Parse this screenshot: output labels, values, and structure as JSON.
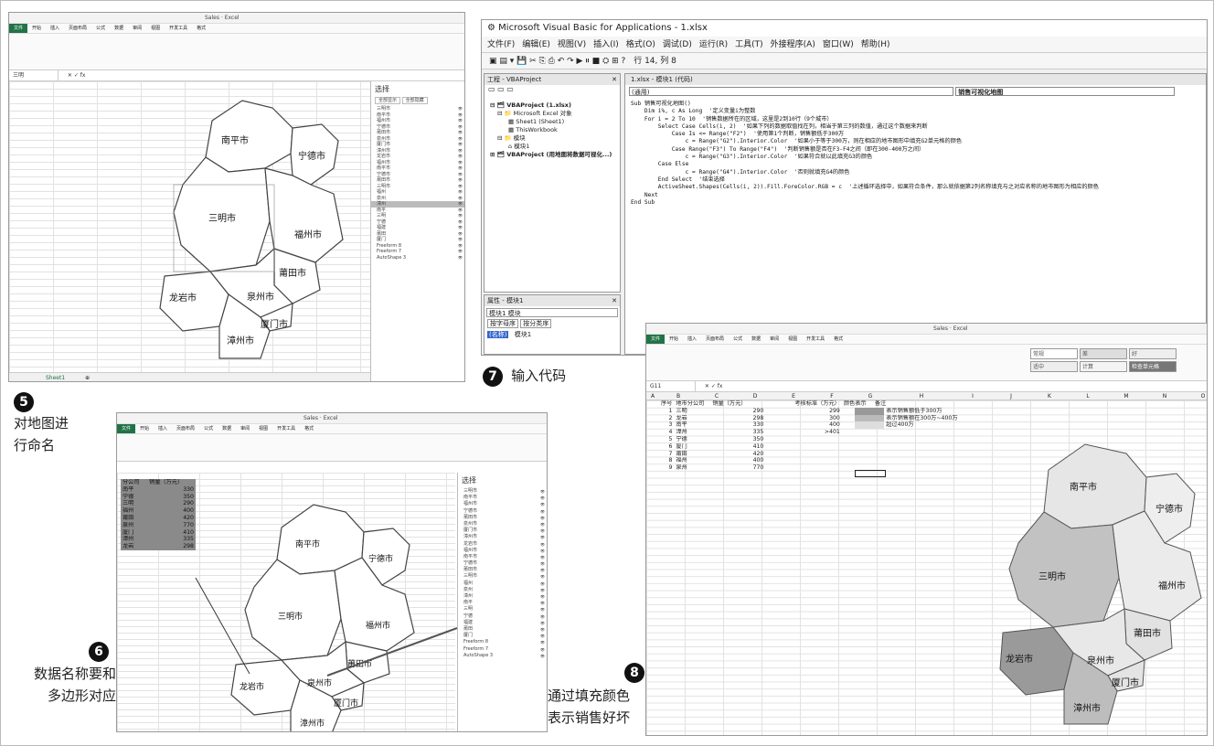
{
  "shot5": {
    "window_title": "Sales · Excel",
    "tabs": [
      "文件",
      "开始",
      "插入",
      "页面布局",
      "公式",
      "数据",
      "审阅",
      "视图",
      "开发工具",
      "格式"
    ],
    "name_box": "三明",
    "sheet_tab": "Sheet1",
    "selection_pane": {
      "title": "选择",
      "show_all": "全部显示",
      "hide_all": "全部隐藏",
      "items": [
        "三明市",
        "南平市",
        "福州市",
        "宁德市",
        "莆田市",
        "泉州市",
        "厦门市",
        "漳州市",
        "龙岩市",
        "福州市",
        "南平市",
        "宁德市",
        "莆田市",
        "三明市",
        "福州",
        "泉州",
        "漳州",
        "南平",
        "三明",
        "宁德",
        "福建",
        "莆田",
        "厦门",
        "Freeform 8",
        "Freeform 7",
        "AutoShape 3"
      ]
    },
    "map_labels": [
      "南平市",
      "宁德市",
      "三明市",
      "福州市",
      "莆田市",
      "龙岩市",
      "泉州市",
      "厦门市",
      "漳州市"
    ]
  },
  "step5": {
    "number": "5",
    "caption_line1": "对地图进",
    "caption_line2": "行命名"
  },
  "step6": {
    "number": "6",
    "caption_line1": "数据名称要和",
    "caption_line2": "多边形对应"
  },
  "step7": {
    "number": "7",
    "caption": "输入代码"
  },
  "step8": {
    "number": "8",
    "caption_line1": "通过填充颜色",
    "caption_line2": "表示销售好坏"
  },
  "shot6": {
    "window_title": "Sales · Excel",
    "table_headers": [
      "分公司",
      "销量（万元）"
    ],
    "table_rows": [
      [
        "南平",
        "330"
      ],
      [
        "宁德",
        "350"
      ],
      [
        "三明",
        "290"
      ],
      [
        "福州",
        "400"
      ],
      [
        "莆田",
        "420"
      ],
      [
        "泉州",
        "770"
      ],
      [
        "厦门",
        "410"
      ],
      [
        "漳州",
        "335"
      ],
      [
        "龙岩",
        "298"
      ]
    ],
    "map_labels": [
      "南平市",
      "宁德市",
      "三明市",
      "福州市",
      "莆田市",
      "龙岩市",
      "泉州市",
      "厦门市",
      "漳州市"
    ]
  },
  "shot7": {
    "title": "Microsoft Visual Basic for Applications - 1.xlsx",
    "menu": [
      "文件(F)",
      "编辑(E)",
      "视图(V)",
      "插入(I)",
      "格式(O)",
      "调试(D)",
      "运行(R)",
      "工具(T)",
      "外接程序(A)",
      "窗口(W)",
      "帮助(H)"
    ],
    "position": "行 14, 列 8",
    "project_title": "工程 - VBAProject",
    "tree": [
      "VBAProject (1.xlsx)",
      "Microsoft Excel 对象",
      "Sheet1 (Sheet1)",
      "ThisWorkbook",
      "模块",
      "模块1",
      "VBAProject (用地图将数据可视化...)"
    ],
    "props_title": "属性 - 模块1",
    "props_select": "模块1 模块",
    "props_tabs": [
      "按字母序",
      "按分类序"
    ],
    "props_row": [
      "(名称)",
      "模块1"
    ],
    "code_title": "1.xlsx - 模块1 (代码)",
    "combo_left": "(通用)",
    "combo_right": "销售可视化地图",
    "code_lines": [
      "Sub 销售可视化地图()",
      "    Dim i%, c As Long  '定义变量i为整数",
      "    For i = 2 To 10  '销售数据所在的区域，这里是2到10行（9个城市）",
      "        Select Case Cells(i, 2)  '如果下列的数据取值找在列，相当于第三列的数值，通过这个数据来判断",
      "            Case Is <= Range(\"F2\")  '使用第1个判断，销售额低于300万",
      "                c = Range(\"G2\").Interior.Color  '如果小于等于300万，则在相应的地市图形中填充G2单元格的颜色",
      "            Case Range(\"F3\") To Range(\"F4\")  '判断销售额是否在F3-F4之间（即在300-400万之间）",
      "                c = Range(\"G3\").Interior.Color  '如果符合就以此填充G3的颜色",
      "        Case Else",
      "                c = Range(\"G4\").Interior.Color  '否则就填充G4的颜色",
      "        End Select  '结束选择",
      "        ActiveSheet.Shapes(Cells(i, 2)).Fill.ForeColor.RGB = c  '上述循环选择中，如果符合条件，那么就依据第2列名称填充与之对应名称的地市图形为相应的颜色",
      "    Next",
      "End Sub"
    ]
  },
  "shot8": {
    "window_title": "Sales · Excel",
    "name_box": "G11",
    "styles": [
      "常规",
      "差",
      "好",
      "适中",
      "计算",
      "检查单元格"
    ],
    "col_headers": [
      "A",
      "B",
      "C",
      "D",
      "E",
      "F",
      "G",
      "H",
      "I",
      "J",
      "K",
      "L",
      "M",
      "N",
      "O"
    ],
    "table_headers": [
      "序号",
      "地市分公司",
      "销量（万元）",
      "",
      "考核标准（万元）",
      "颜色表示",
      "备注"
    ],
    "table_rows": [
      [
        "1",
        "三明",
        "290",
        "",
        "299",
        "",
        "差，表示销售额低于300万"
      ],
      [
        "2",
        "龙岩",
        "298",
        "",
        "300",
        "",
        "中，表示销售额在300万~400万"
      ],
      [
        "3",
        "南平",
        "330",
        "",
        "400",
        "",
        "好，超过400万"
      ],
      [
        "4",
        "漳州",
        "335",
        "",
        ">401",
        "",
        ""
      ],
      [
        "5",
        "宁德",
        "350",
        "",
        "",
        "",
        ""
      ],
      [
        "6",
        "厦门",
        "410",
        "",
        "",
        "",
        ""
      ],
      [
        "7",
        "莆田",
        "420",
        "",
        "",
        "",
        ""
      ],
      [
        "8",
        "福州",
        "400",
        "",
        "",
        "",
        ""
      ],
      [
        "9",
        "泉州",
        "770",
        "",
        "",
        "",
        ""
      ]
    ],
    "map_labels": [
      "南平市",
      "宁德市",
      "三明市",
      "福州市",
      "莆田市",
      "龙岩市",
      "泉州市",
      "厦门市",
      "漳州市"
    ]
  }
}
